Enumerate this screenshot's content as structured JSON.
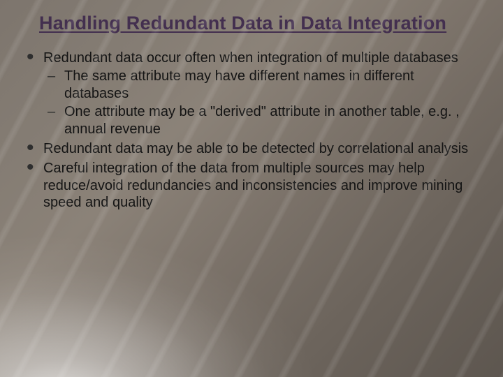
{
  "title": "Handling Redundant Data in Data Integration",
  "bullets": [
    {
      "text": "Redundant data occur often when integration of multiple databases",
      "sub": [
        "The same attribute may have different names in different databases",
        "One attribute may be a \"derived\" attribute in another table, e.g. , annual revenue"
      ]
    },
    {
      "text": "Redundant data may be able to be detected by correlational analysis",
      "sub": []
    },
    {
      "text": "Careful integration of the data from multiple sources may help reduce/avoid redundancies and inconsistencies and improve mining speed and quality",
      "sub": []
    }
  ]
}
